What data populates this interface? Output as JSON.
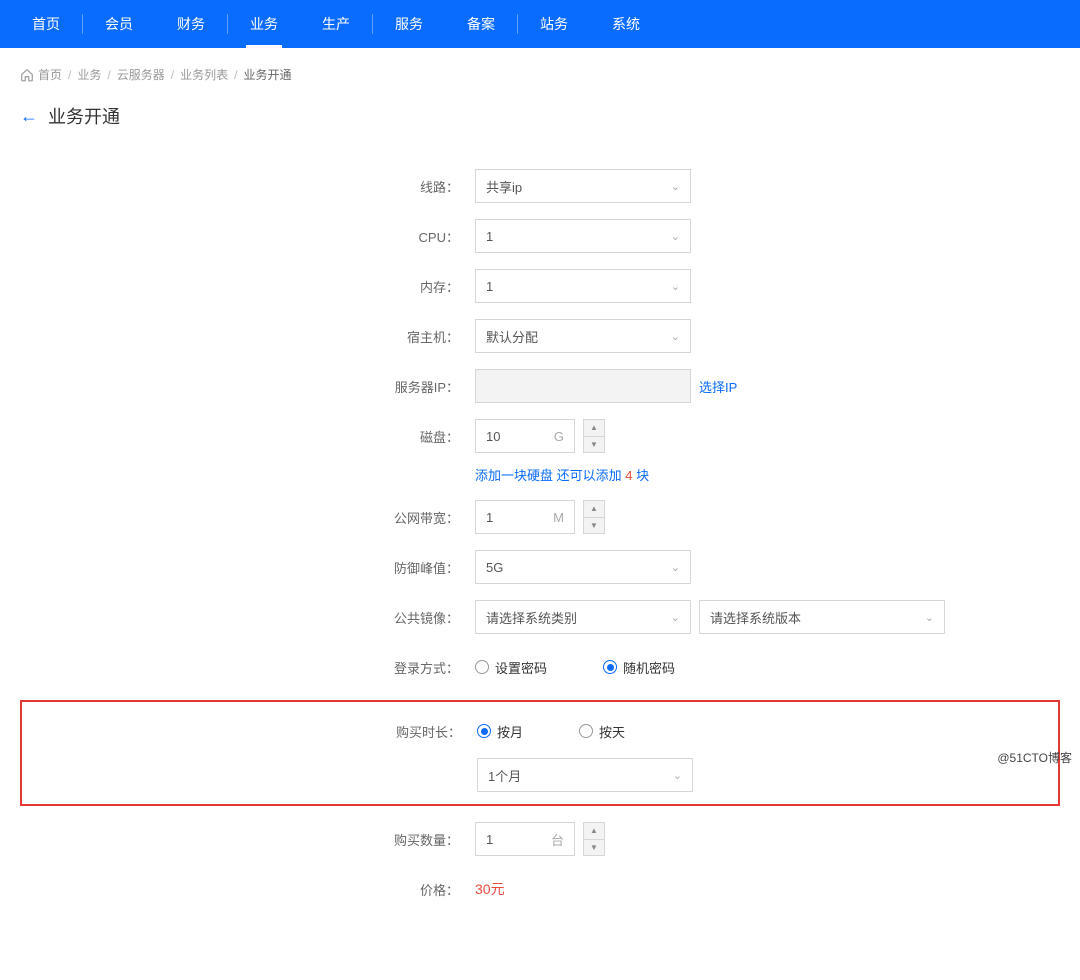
{
  "nav": {
    "groups": [
      [
        "首页"
      ],
      [
        "会员",
        "财务"
      ],
      [
        "业务",
        "生产"
      ],
      [
        "服务",
        "备案"
      ],
      [
        "站务",
        "系统"
      ]
    ],
    "active": "业务"
  },
  "breadcrumb": {
    "items": [
      "首页",
      "业务",
      "云服务器",
      "业务列表",
      "业务开通"
    ]
  },
  "page": {
    "title": "业务开通"
  },
  "form": {
    "line": {
      "label": "线路：",
      "value": "共享ip"
    },
    "cpu": {
      "label": "CPU：",
      "value": "1"
    },
    "mem": {
      "label": "内存：",
      "value": "1"
    },
    "host": {
      "label": "宿主机：",
      "value": "默认分配"
    },
    "server_ip": {
      "label": "服务器IP：",
      "value": "",
      "action": "选择IP"
    },
    "disk": {
      "label": "磁盘：",
      "value": "10",
      "unit": "G"
    },
    "disk_hint_prefix": "添加一块硬盘 还可以添加 ",
    "disk_hint_count": "4",
    "disk_hint_suffix": " 块",
    "bandwidth": {
      "label": "公网带宽：",
      "value": "1",
      "unit": "M"
    },
    "defense": {
      "label": "防御峰值：",
      "value": "5G"
    },
    "image": {
      "label": "公共镜像：",
      "value1": "请选择系统类别",
      "value2": "请选择系统版本"
    },
    "login": {
      "label": "登录方式：",
      "opt1": "设置密码",
      "opt2": "随机密码",
      "selected": "opt2"
    },
    "duration": {
      "label": "购买时长：",
      "opt1": "按月",
      "opt2": "按天",
      "selected": "opt1",
      "value": "1个月"
    },
    "qty": {
      "label": "购买数量：",
      "value": "1",
      "unit": "台"
    },
    "price": {
      "label": "价格：",
      "value": "30元"
    }
  },
  "watermark": "@51CTO博客"
}
